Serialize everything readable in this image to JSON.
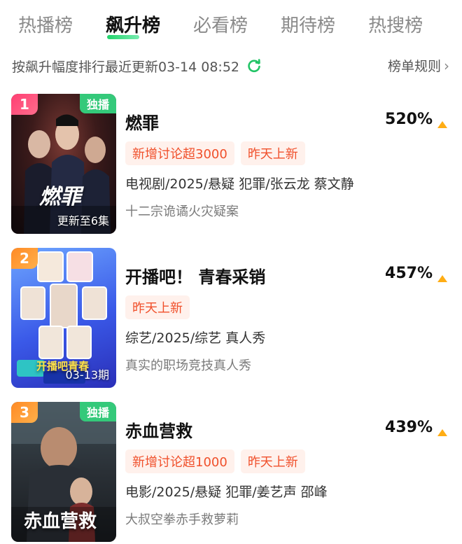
{
  "tabs": [
    {
      "label": "热播榜",
      "active": false
    },
    {
      "label": "飙升榜",
      "active": true
    },
    {
      "label": "必看榜",
      "active": false
    },
    {
      "label": "期待榜",
      "active": false
    },
    {
      "label": "热搜榜",
      "active": false
    }
  ],
  "subheader": {
    "sort_text": "按飙升幅度排行最近更新03-14 08:52",
    "rules_label": "榜单规则",
    "rules_icon": "chevron-right-icon",
    "refresh_icon": "refresh-icon"
  },
  "items": [
    {
      "rank": "1",
      "badge": "独播",
      "poster_wordmark": "燃罪",
      "poster_caption": "更新至6集",
      "title": "燃罪",
      "percent": "520%",
      "tags": [
        "新增讨论超3000",
        "昨天上新"
      ],
      "meta": "电视剧/2025/悬疑 犯罪/张云龙 蔡文静",
      "desc": "十二宗诡谲火灾疑案"
    },
    {
      "rank": "2",
      "badge": "",
      "poster_wordmark": "开播吧青春",
      "poster_caption": "03-13期",
      "title": "开播吧！ 青春采销",
      "percent": "457%",
      "tags": [
        "昨天上新"
      ],
      "meta": "综艺/2025/综艺 真人秀",
      "desc": "真实的职场竞技真人秀"
    },
    {
      "rank": "3",
      "badge": "独播",
      "poster_wordmark": "赤血营救",
      "poster_caption": "",
      "title": "赤血营救",
      "percent": "439%",
      "tags": [
        "新增讨论超1000",
        "昨天上新"
      ],
      "meta": "电影/2025/悬疑 犯罪/姜艺声 邵峰",
      "desc": "大叔空拳赤手救萝莉"
    }
  ],
  "colors": {
    "accent_green": "#22d36b",
    "tag_bg": "#fff1ec",
    "tag_text": "#f0502b",
    "up_arrow": "#ffad14",
    "rank1": "#ff3f73",
    "rank_other": "#ff8a25",
    "exclusive_badge": "#34c97a"
  }
}
